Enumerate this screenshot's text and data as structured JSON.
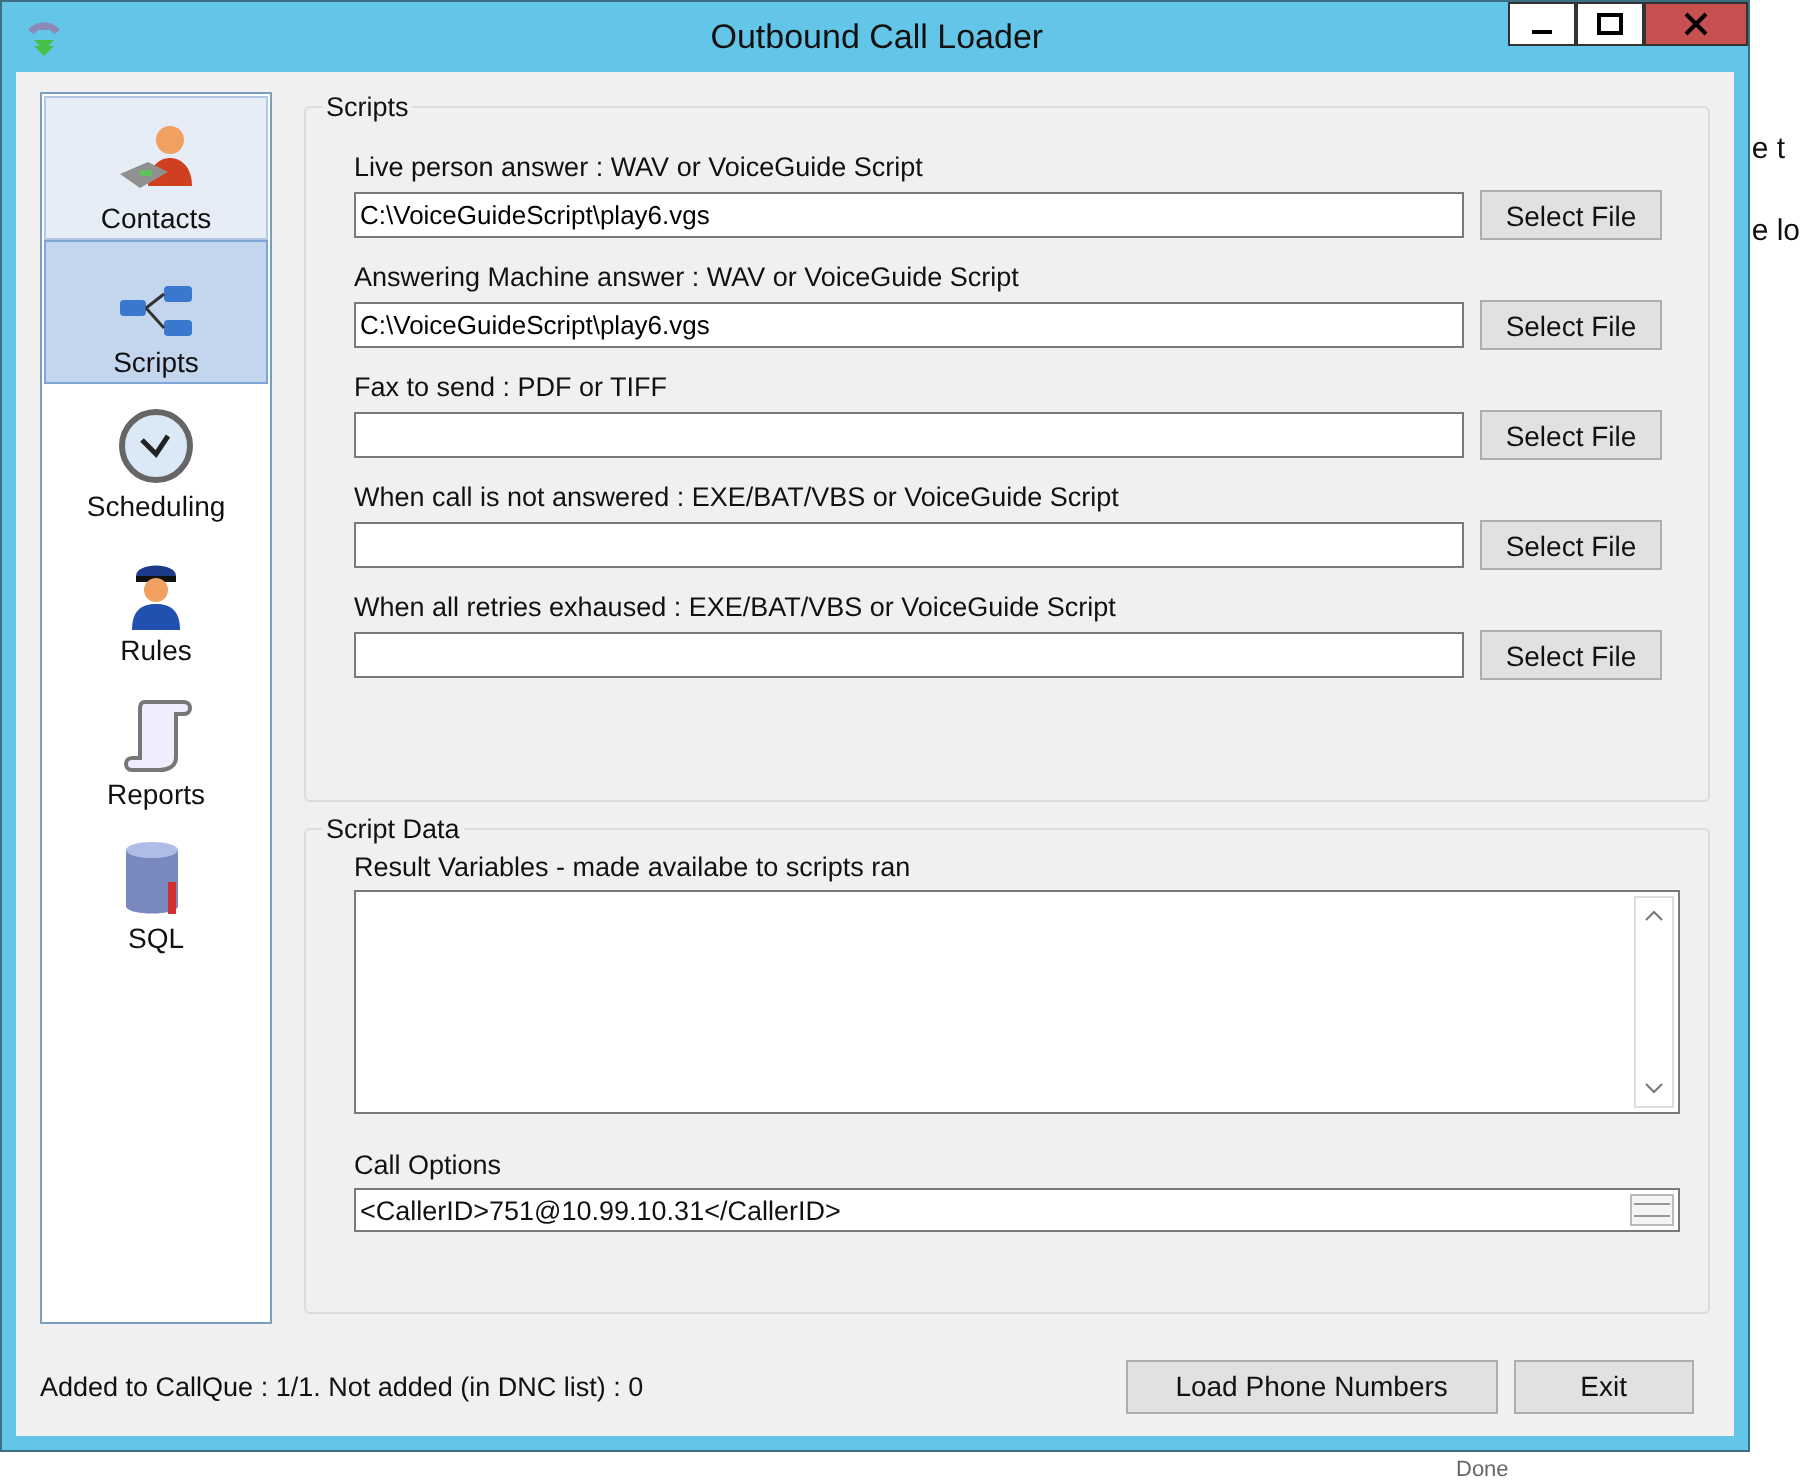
{
  "window": {
    "title": "Outbound Call Loader"
  },
  "sidebar": {
    "items": [
      {
        "label": "Contacts",
        "selected": false,
        "hovered": true
      },
      {
        "label": "Scripts",
        "selected": true,
        "hovered": false
      },
      {
        "label": "Scheduling",
        "selected": false,
        "hovered": false
      },
      {
        "label": "Rules",
        "selected": false,
        "hovered": false
      },
      {
        "label": "Reports",
        "selected": false,
        "hovered": false
      },
      {
        "label": "SQL",
        "selected": false,
        "hovered": false
      }
    ]
  },
  "scripts": {
    "title": "Scripts",
    "fields": [
      {
        "label": "Live person answer : WAV or VoiceGuide Script",
        "value": "C:\\VoiceGuideScript\\play6.vgs",
        "button": "Select File"
      },
      {
        "label": "Answering Machine answer : WAV or VoiceGuide Script",
        "value": "C:\\VoiceGuideScript\\play6.vgs",
        "button": "Select File"
      },
      {
        "label": "Fax to send : PDF or TIFF",
        "button": "Select File"
      },
      {
        "label": "When call is not answered : EXE/BAT/VBS or VoiceGuide Script",
        "button": "Select File"
      },
      {
        "label": "When all retries exhaused : EXE/BAT/VBS or VoiceGuide Script",
        "button": "Select File"
      }
    ]
  },
  "script_data": {
    "title": "Script Data",
    "result_label": "Result Variables - made availabe to scripts ran",
    "call_options_label": "Call Options",
    "call_options": "<CallerID>751@10.99.10.31</CallerID>"
  },
  "status": "Added to CallQue : 1/1. Not added (in DNC list) : 0",
  "buttons": [
    "Load Phone Numbers",
    "Exit"
  ],
  "background_text": [
    "e t",
    "e lo",
    "Done"
  ]
}
